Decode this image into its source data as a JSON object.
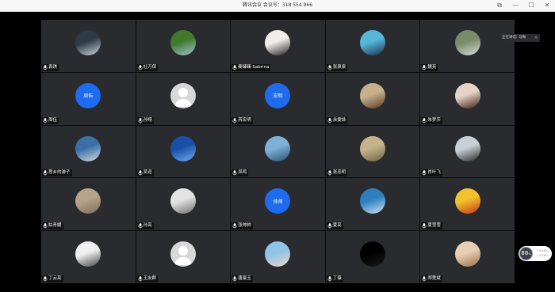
{
  "window": {
    "title": "腾讯会议  会议号：318 554 966",
    "buttons": [
      "⧉",
      "—",
      "☐",
      "✕"
    ]
  },
  "speaking": {
    "label": "正在讲话: 马梅",
    "close": "✕"
  },
  "net_monitor": {
    "value": "88",
    "unit": "%",
    "up": "↑ 0.4K/s",
    "down": "↓ 0.4K/s"
  },
  "participants": [
    {
      "name": "袁琪",
      "avatar": "photo",
      "colors": [
        "#2e3a46",
        "#c9d4de"
      ]
    },
    {
      "name": "杜万保",
      "avatar": "photo",
      "colors": [
        "#3f7a2c",
        "#a7c0d6"
      ]
    },
    {
      "name": "秦臻臻 Sabrina",
      "avatar": "photo",
      "colors": [
        "#f1eeea",
        "#2a2222"
      ]
    },
    {
      "name": "张泉泉",
      "avatar": "photo",
      "colors": [
        "#56b7db",
        "#1c3050"
      ]
    },
    {
      "name": "魏亮",
      "avatar": "photo",
      "colors": [
        "#7a8b6a",
        "#d8dcd9"
      ]
    },
    {
      "name": "周伍",
      "avatar": "initials",
      "initials": "周伍",
      "colors": [
        "#1e6bf0",
        "#1e6bf0"
      ]
    },
    {
      "name": "孙翔",
      "avatar": "default",
      "colors": [
        "#d8d8d8",
        "#ffffff"
      ]
    },
    {
      "name": "芮宏明",
      "avatar": "initials",
      "initials": "宏明",
      "colors": [
        "#1e6bf0",
        "#1e6bf0"
      ]
    },
    {
      "name": "余雯詠",
      "avatar": "photo",
      "colors": [
        "#c7b18d",
        "#5a3a26"
      ]
    },
    {
      "name": "朱梦莎",
      "avatar": "photo",
      "colors": [
        "#e6d2c6",
        "#3b1d16"
      ]
    },
    {
      "name": "思乡的游子",
      "avatar": "photo",
      "colors": [
        "#3a6fa6",
        "#d6dbe0"
      ]
    },
    {
      "name": "吴迎",
      "avatar": "photo",
      "colors": [
        "#1b4ea8",
        "#6db0f0"
      ]
    },
    {
      "name": "凤鸣",
      "avatar": "photo",
      "colors": [
        "#7fb1d6",
        "#2b4f72"
      ]
    },
    {
      "name": "张忠明",
      "avatar": "photo",
      "colors": [
        "#c6b38a",
        "#6c6048"
      ]
    },
    {
      "name": "肖叶飞",
      "avatar": "photo",
      "colors": [
        "#c9cfd6",
        "#2a2a2a"
      ]
    },
    {
      "name": "姑青媛",
      "avatar": "photo",
      "colors": [
        "#b7a38b",
        "#7a6a58"
      ]
    },
    {
      "name": "孙亮",
      "avatar": "photo",
      "colors": [
        "#e4e4e4",
        "#6e6e6e"
      ]
    },
    {
      "name": "张帅帅",
      "avatar": "initials",
      "initials": "帅帅",
      "colors": [
        "#1e6bf0",
        "#1e6bf0"
      ]
    },
    {
      "name": "夏亮",
      "avatar": "photo",
      "colors": [
        "#2e7fbf",
        "#cfe3f0"
      ]
    },
    {
      "name": "夏莹莹",
      "avatar": "photo",
      "colors": [
        "#f2c12e",
        "#c4361f"
      ]
    },
    {
      "name": "丁云亮",
      "avatar": "photo",
      "colors": [
        "#f0f0f0",
        "#444444"
      ]
    },
    {
      "name": "王友群",
      "avatar": "default",
      "colors": [
        "#d8d8d8",
        "#ffffff"
      ]
    },
    {
      "name": "唐曼玉",
      "avatar": "photo",
      "colors": [
        "#8fc3e8",
        "#e9d8c5"
      ]
    },
    {
      "name": "丁薇",
      "avatar": "photo",
      "colors": [
        "#000000",
        "#1a1a1a"
      ]
    },
    {
      "name": "郑楚斌",
      "avatar": "photo",
      "colors": [
        "#e7cfb3",
        "#9a6c4c"
      ]
    }
  ]
}
